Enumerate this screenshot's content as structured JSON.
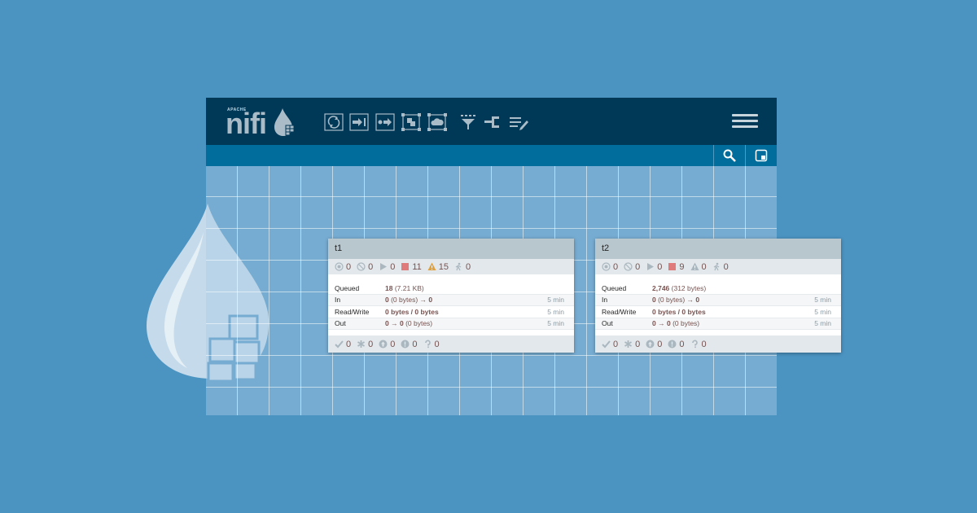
{
  "logo": {
    "apache": "APACHE",
    "word": "nifi"
  },
  "toolbar": {
    "items": [
      {
        "name": "processor"
      },
      {
        "name": "input-port"
      },
      {
        "name": "output-port"
      },
      {
        "name": "process-group"
      },
      {
        "name": "remote-process-group"
      },
      {
        "name": "funnel"
      },
      {
        "name": "template"
      },
      {
        "name": "label"
      }
    ],
    "menu_icon": "hamburger-icon",
    "search_icon": "search-icon",
    "navigate_icon": "birdseye-icon"
  },
  "colors": {
    "topbar": "#003857",
    "subbar": "#006d9c",
    "background": "#4b93c1",
    "value": "#775351",
    "stopped": "#e07b7b",
    "invalid": "#e0a240"
  },
  "groups": [
    {
      "title": "t1",
      "stats": {
        "transmitting": "0",
        "not_transmitting": "0",
        "running": "0",
        "stopped": "11",
        "invalid": "15",
        "disabled": "0"
      },
      "rows": [
        {
          "label": "Queued",
          "value_bold": "18",
          "value_rest": " (7.21 KB)",
          "time": ""
        },
        {
          "label": "In",
          "value_bold": "0",
          "value_rest": " (0 bytes) → ",
          "value_bold2": "0",
          "time": "5 min"
        },
        {
          "label": "Read/Write",
          "value_bold": "0 bytes / 0 bytes",
          "value_rest": "",
          "time": "5 min"
        },
        {
          "label": "Out",
          "value_bold": "0",
          "value_rest": " → ",
          "value_bold2": "0",
          "value_rest2": " (0 bytes)",
          "time": "5 min"
        }
      ],
      "footer": {
        "up_to_date": "0",
        "locally_modified": "0",
        "stale": "0",
        "locally_modified_stale": "0",
        "sync_failure": "0"
      }
    },
    {
      "title": "t2",
      "stats": {
        "transmitting": "0",
        "not_transmitting": "0",
        "running": "0",
        "stopped": "9",
        "invalid": "0",
        "disabled": "0"
      },
      "rows": [
        {
          "label": "Queued",
          "value_bold": "2,746",
          "value_rest": " (312 bytes)",
          "time": ""
        },
        {
          "label": "In",
          "value_bold": "0",
          "value_rest": " (0 bytes) → ",
          "value_bold2": "0",
          "time": "5 min"
        },
        {
          "label": "Read/Write",
          "value_bold": "0 bytes / 0 bytes",
          "value_rest": "",
          "time": "5 min"
        },
        {
          "label": "Out",
          "value_bold": "0",
          "value_rest": " → ",
          "value_bold2": "0",
          "value_rest2": " (0 bytes)",
          "time": "5 min"
        }
      ],
      "footer": {
        "up_to_date": "0",
        "locally_modified": "0",
        "stale": "0",
        "locally_modified_stale": "0",
        "sync_failure": "0"
      }
    }
  ]
}
